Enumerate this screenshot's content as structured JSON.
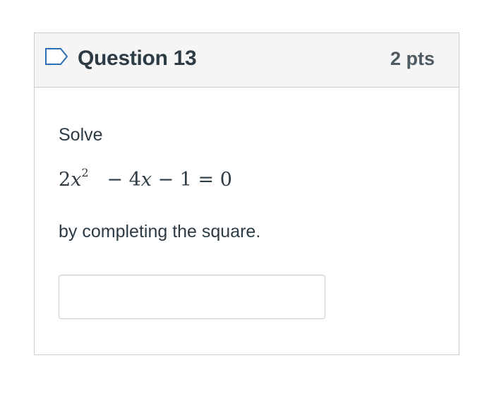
{
  "question": {
    "title": "Question 13",
    "points": "2 pts",
    "flag_icon": "flag-outline-icon"
  },
  "body": {
    "prompt": "Solve",
    "equation": {
      "coef1": "2",
      "var1": "x",
      "exp": "2",
      "minus1": "− 4",
      "var2": "x",
      "rest": "− 1 = 0"
    },
    "method": "by completing the square.",
    "answer_value": "",
    "answer_placeholder": ""
  },
  "colors": {
    "header_bg": "#f5f5f5",
    "border": "#c7cdd1",
    "text": "#2d3b45",
    "flag_stroke": "#2b6fb6"
  }
}
